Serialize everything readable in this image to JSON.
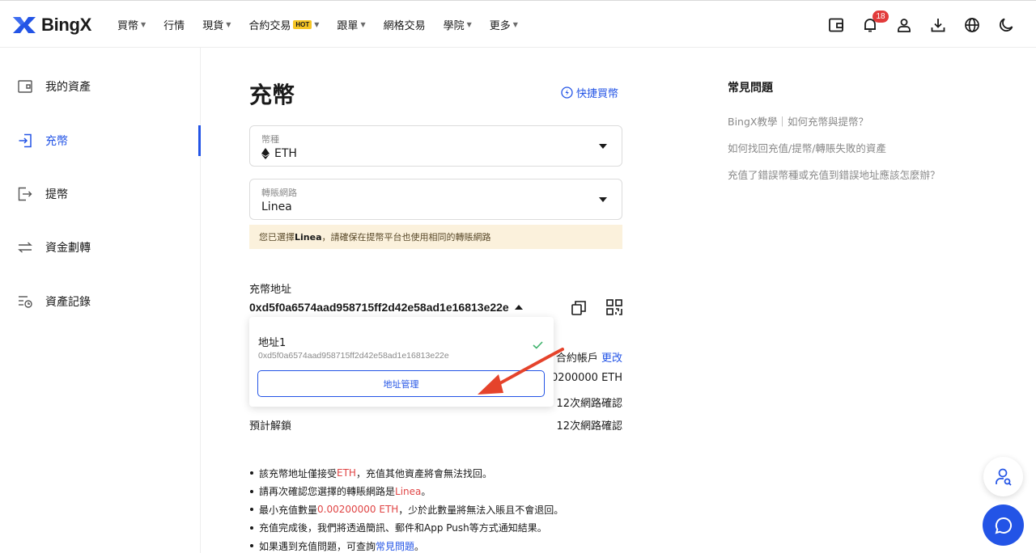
{
  "brand": {
    "name": "BingX",
    "accent": "#2354e6",
    "warning_bg": "#fbf1dc",
    "highlight_red": "#e04545"
  },
  "nav": {
    "items": [
      {
        "label": "買幣",
        "caret": true
      },
      {
        "label": "行情",
        "caret": false
      },
      {
        "label": "現貨",
        "caret": true
      },
      {
        "label": "合約交易",
        "caret": true,
        "badge": "HOT"
      },
      {
        "label": "跟單",
        "caret": true
      },
      {
        "label": "網格交易",
        "caret": false
      },
      {
        "label": "學院",
        "caret": true
      },
      {
        "label": "更多",
        "caret": true
      }
    ],
    "icons": [
      "wallet-icon",
      "bell-icon",
      "user-icon",
      "download-icon",
      "globe-icon",
      "moon-icon"
    ],
    "notification_count": "18"
  },
  "sidebar": {
    "items": [
      {
        "label": "我的資產",
        "icon": "wallet-icon"
      },
      {
        "label": "充幣",
        "icon": "deposit-icon",
        "active": true
      },
      {
        "label": "提幣",
        "icon": "withdraw-icon"
      },
      {
        "label": "資金劃轉",
        "icon": "transfer-icon"
      },
      {
        "label": "資產記錄",
        "icon": "records-icon"
      }
    ]
  },
  "main": {
    "title": "充幣",
    "quick_buy": "快捷買幣",
    "coin": {
      "caption": "幣種",
      "value": "ETH",
      "icon": "ethereum-icon"
    },
    "network": {
      "caption": "轉賬網路",
      "value": "Linea"
    },
    "notice": {
      "prefix": "您已選擇",
      "network": "Linea",
      "suffix": "，請確保在提幣平台也使用相同的轉賬網路"
    },
    "address": {
      "label": "充幣地址",
      "value": "0xd5f0a6574aad958715ff2d42e58ad1e16813e22e"
    },
    "info": {
      "row1_right": "合約帳戶",
      "row1_link": "更改",
      "row2_right": "00200000 ETH",
      "row3_right": "12次網路確認",
      "row4_left": "預計解鎖",
      "row4_right": "12次網路確認"
    },
    "dropdown": {
      "title": "地址1",
      "address": "0xd5f0a6574aad958715ff2d42e58ad1e16813e22e",
      "manage": "地址管理"
    },
    "tips": {
      "t1_a": "該充幣地址僅接受",
      "t1_b": "ETH",
      "t1_c": "，充值其他資產將會無法找回。",
      "t2_a": "請再次確認您選擇的轉賬網路是",
      "t2_b": "Linea",
      "t2_c": "。",
      "t3_a": "最小充值數量",
      "t3_b": "0.00200000 ETH",
      "t3_c": "，少於此數量將無法入賬且不會退回。",
      "t4": "充值完成後，我們將透過簡訊、郵件和App Push等方式通知結果。",
      "t5_a": "如果遇到充值問題，可查詢",
      "t5_b": "常見問題",
      "t5_c": "。"
    }
  },
  "faq": {
    "title": "常見問題",
    "items": [
      "BingX教學｜如何充幣與提幣？",
      "如何找回充值/提幣/轉賬失敗的資產",
      "充值了錯誤幣種或充值到錯誤地址應該怎麼辦？"
    ]
  }
}
